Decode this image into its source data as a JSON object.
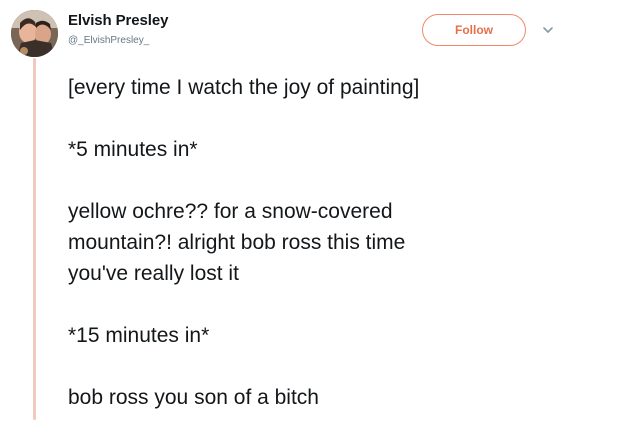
{
  "tweet": {
    "author_name": "Elvish Presley",
    "author_handle": "@_ElvishPresley_",
    "follow_label": "Follow",
    "avatar_icon": "profile-photo",
    "menu_icon": "chevron-down-icon",
    "accent_color": "#e66f4a",
    "thread_line_color": "#f0c9c0",
    "lines": [
      "[every time I watch the joy of painting]",
      "*5 minutes in*",
      "yellow ochre?? for a snow-covered",
      "mountain?! alright bob ross this time",
      "you've really lost it",
      "*15 minutes in*",
      "bob ross you son of a bitch"
    ]
  }
}
